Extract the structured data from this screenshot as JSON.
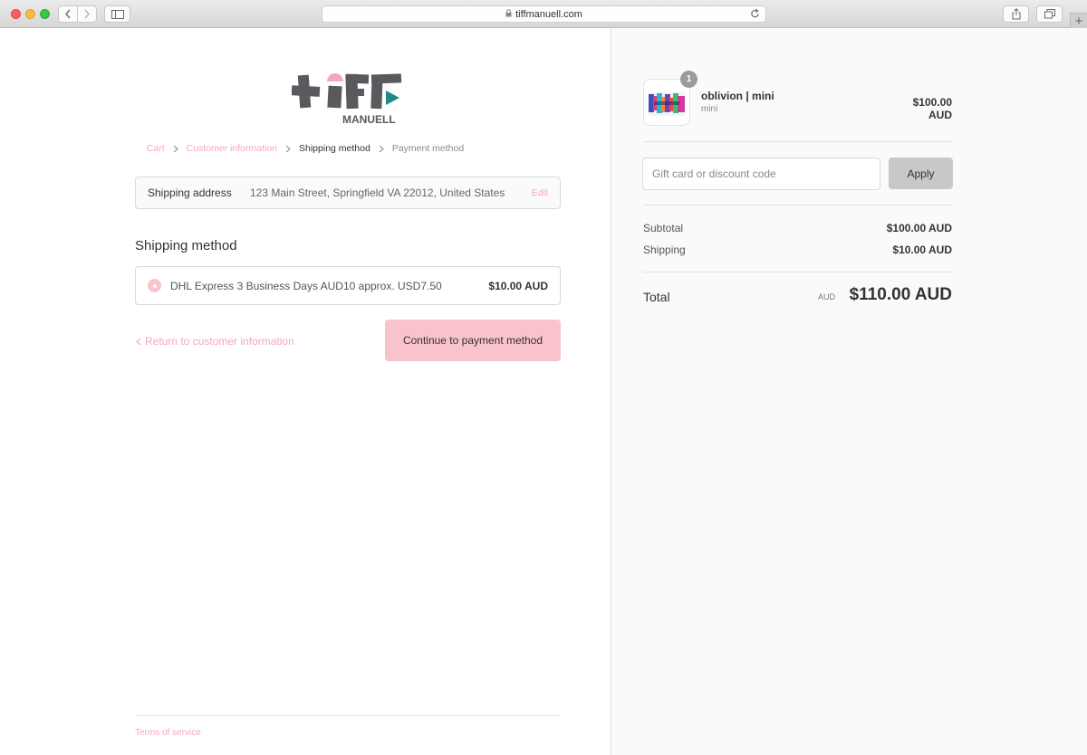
{
  "browser": {
    "url": "tiffmanuell.com",
    "new_tab_label": "+"
  },
  "store": {
    "logo_text_top": "tiff",
    "logo_text_bottom": "MANUELL"
  },
  "breadcrumb": {
    "cart": "Cart",
    "customer_information": "Customer information",
    "shipping_method": "Shipping method",
    "payment_method": "Payment method"
  },
  "shipping_address": {
    "label": "Shipping address",
    "value": "123 Main Street, Springfield VA 22012, United States",
    "edit_label": "Edit"
  },
  "shipping_method": {
    "title": "Shipping method",
    "option_name": "DHL Express 3 Business Days AUD10 approx. USD7.50",
    "option_price": "$10.00 AUD"
  },
  "actions": {
    "return_label": "Return to customer information",
    "continue_label": "Continue to payment method"
  },
  "footer": {
    "terms": "Terms of service"
  },
  "order": {
    "item": {
      "name": "oblivion | mini",
      "variant": "mini",
      "quantity": "1",
      "price": "$100.00 AUD"
    },
    "discount": {
      "placeholder": "Gift card or discount code",
      "apply_label": "Apply"
    },
    "subtotal_label": "Subtotal",
    "subtotal_value": "$100.00 AUD",
    "shipping_label": "Shipping",
    "shipping_value": "$10.00 AUD",
    "total_label": "Total",
    "total_currency": "AUD",
    "total_value": "$110.00 AUD"
  },
  "colors": {
    "accent_pink": "#f9c3cc",
    "link_pink": "#f6a7b6",
    "logo_gray": "#5a5a5e",
    "logo_teal": "#1f8a8a",
    "logo_pink": "#f6a7b6"
  }
}
